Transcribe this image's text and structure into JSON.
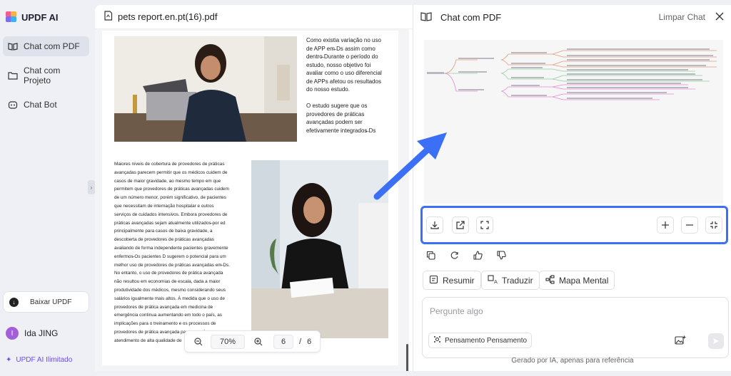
{
  "app": {
    "name": "UPDF AI",
    "logo_colors": [
      "#f35c8b",
      "#ffb23f",
      "#3bb2f6",
      "#7b6df2"
    ]
  },
  "sidebar": {
    "items": [
      {
        "label": "Chat com PDF",
        "icon": "book-open-icon",
        "active": true
      },
      {
        "label": "Chat com Projeto",
        "icon": "folder-icon",
        "active": false
      },
      {
        "label": "Chat Bot",
        "icon": "bot-icon",
        "active": false
      }
    ],
    "download_label": "Baixar UPDF",
    "user": {
      "initial": "I",
      "name": "Ida JING"
    },
    "unlimited_label": "UPDF AI Ilimitado"
  },
  "pdf": {
    "filename": "pets report.en.pt(16).pdf",
    "right_text": [
      "Como existia variação no uso",
      "de APP em̶ Ds assim como",
      "dentro̶ Durante o período do",
      "estudo, nosso objetivo foi",
      "avaliar como o uso diferencial",
      "de APPs afetou os resultados",
      "do nosso estudo.",
      "",
      "O estudo sugere que os",
      "provedores de práticas",
      "avançadas podem ser",
      "efetivamente integrados̶ Ds"
    ],
    "left_text": [
      "Maiores níveis de cobertura de provedores de práticas",
      "avançadas parecem permitir que os médicos cuidem de",
      "casos de maior gravidade, ao mesmo tempo em que",
      "permitem que provedores de práticas avançadas cuidem",
      "de um número menor, porém significativo, de pacientes",
      "que necessitam de internação hospitalar e outros",
      "serviços de cuidados intensivos. Embora provedores de",
      "práticas avançadas sejam atualmente utilizados̶ por ed",
      "principalmente para casos de baixa gravidade, a",
      "descoberta de provedores de práticas avançadas",
      "avaliando de forma independente pacientes gravemente",
      "enfermos̶ Os pacientes D sugerem o potencial para um",
      "melhor uso de provedores de práticas avançadas em̶ Ds.",
      "No entanto, o uso de provedores de prática avançada",
      "não resultou em economias de escala, dada a maior",
      "produtividade dos médicos, mesmo considerando seus",
      "salários igualmente mais altos. À medida que o uso de",
      "provedores de prática avançada em medicina de",
      "emergência continua aumentando em todo o país, as",
      "implicações para o treinamento e os processos de",
      "provedores de prática avançada para garantir um",
      "atendimento de alta qualidade de"
    ],
    "zoom": "70%",
    "current_page": "6",
    "page_separator": "/",
    "total_pages": "6"
  },
  "chat": {
    "title": "Chat com PDF",
    "clear_label": "Limpar Chat",
    "toolbar_left": [
      "download-icon",
      "share-icon",
      "expand-icon"
    ],
    "toolbar_right": [
      "zoom-in-icon",
      "zoom-out-icon",
      "collapse-icon"
    ],
    "message_actions": [
      "copy-icon",
      "regenerate-icon",
      "thumbs-up-icon",
      "thumbs-down-icon"
    ],
    "quick_actions": [
      {
        "label": "Resumir",
        "icon": "summary-icon"
      },
      {
        "label": "Traduzir",
        "icon": "translate-icon"
      },
      {
        "label": "Mapa Mental",
        "icon": "mindmap-icon"
      }
    ],
    "input_placeholder": "Pergunte algo",
    "thinking_label": "Pensamento Pensamento",
    "footer": "Gerado por IA, apenas para referência",
    "accent_color": "#3b6ff5"
  }
}
